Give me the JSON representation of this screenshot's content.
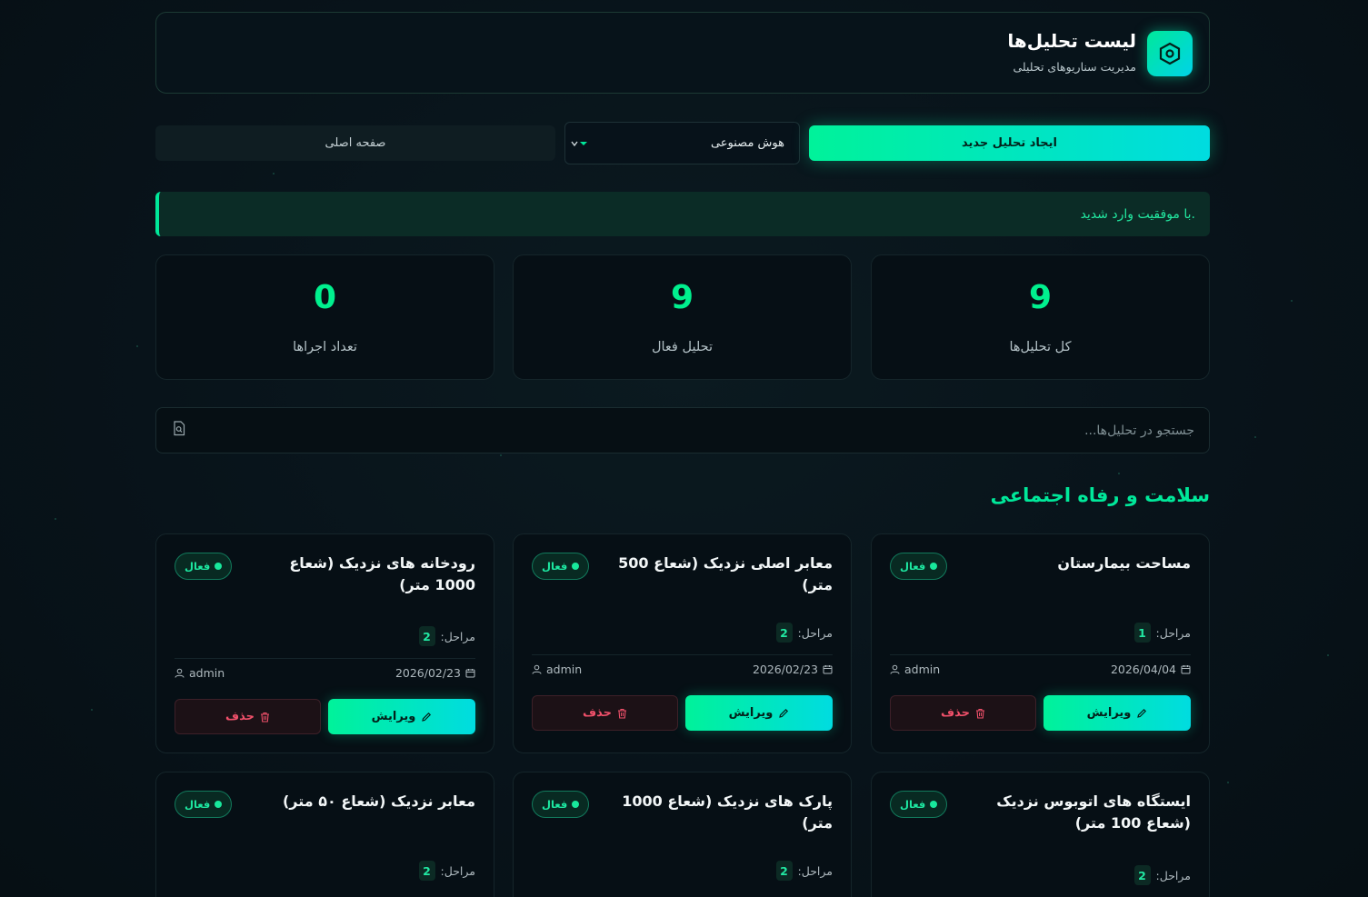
{
  "header": {
    "title": "لیست تحلیل‌ها",
    "subtitle": "مدیریت سناریوهای تحلیلی",
    "logo_icon": "hexagon-icon"
  },
  "toolbar": {
    "home_label": "صفحه اصلی",
    "select_value": "هوش مصنوعی",
    "create_label": "ایجاد تحلیل جدید"
  },
  "alert": {
    "message": "با موفقیت وارد شدید."
  },
  "stats": [
    {
      "value": "9",
      "label": "کل تحلیل‌ها"
    },
    {
      "value": "9",
      "label": "تحلیل فعال"
    },
    {
      "value": "0",
      "label": "تعداد اجراها"
    }
  ],
  "search": {
    "placeholder": "جستجو در تحلیل‌ها...",
    "value": ""
  },
  "section": {
    "title": "سلامت و رفاه اجتماعی"
  },
  "labels": {
    "status": "فعال",
    "steps": "مراحل:",
    "edit": "ویرایش",
    "delete": "حذف"
  },
  "cards": [
    {
      "title": "مساحت بیمارستان",
      "steps": "1",
      "date": "2026/04/04",
      "author": "admin"
    },
    {
      "title": "معابر اصلی نزدیک (شعاع 500 متر)",
      "steps": "2",
      "date": "2026/02/23",
      "author": "admin"
    },
    {
      "title": "رودخانه های نزدیک (شعاع 1000 متر)",
      "steps": "2",
      "date": "2026/02/23",
      "author": "admin"
    },
    {
      "title": "ایستگاه های اتوبوس نزدیک (شعاع 100 متر)",
      "steps": "2"
    },
    {
      "title": "پارک های نزدیک (شعاع 1000 متر)",
      "steps": "2"
    },
    {
      "title": "معابر نزدیک (شعاع ۵۰ متر)",
      "steps": "2"
    }
  ],
  "colors": {
    "accent": "#00f08e",
    "accent_cyan": "#00dce0",
    "danger": "#f0506a",
    "background": "#08131a"
  }
}
